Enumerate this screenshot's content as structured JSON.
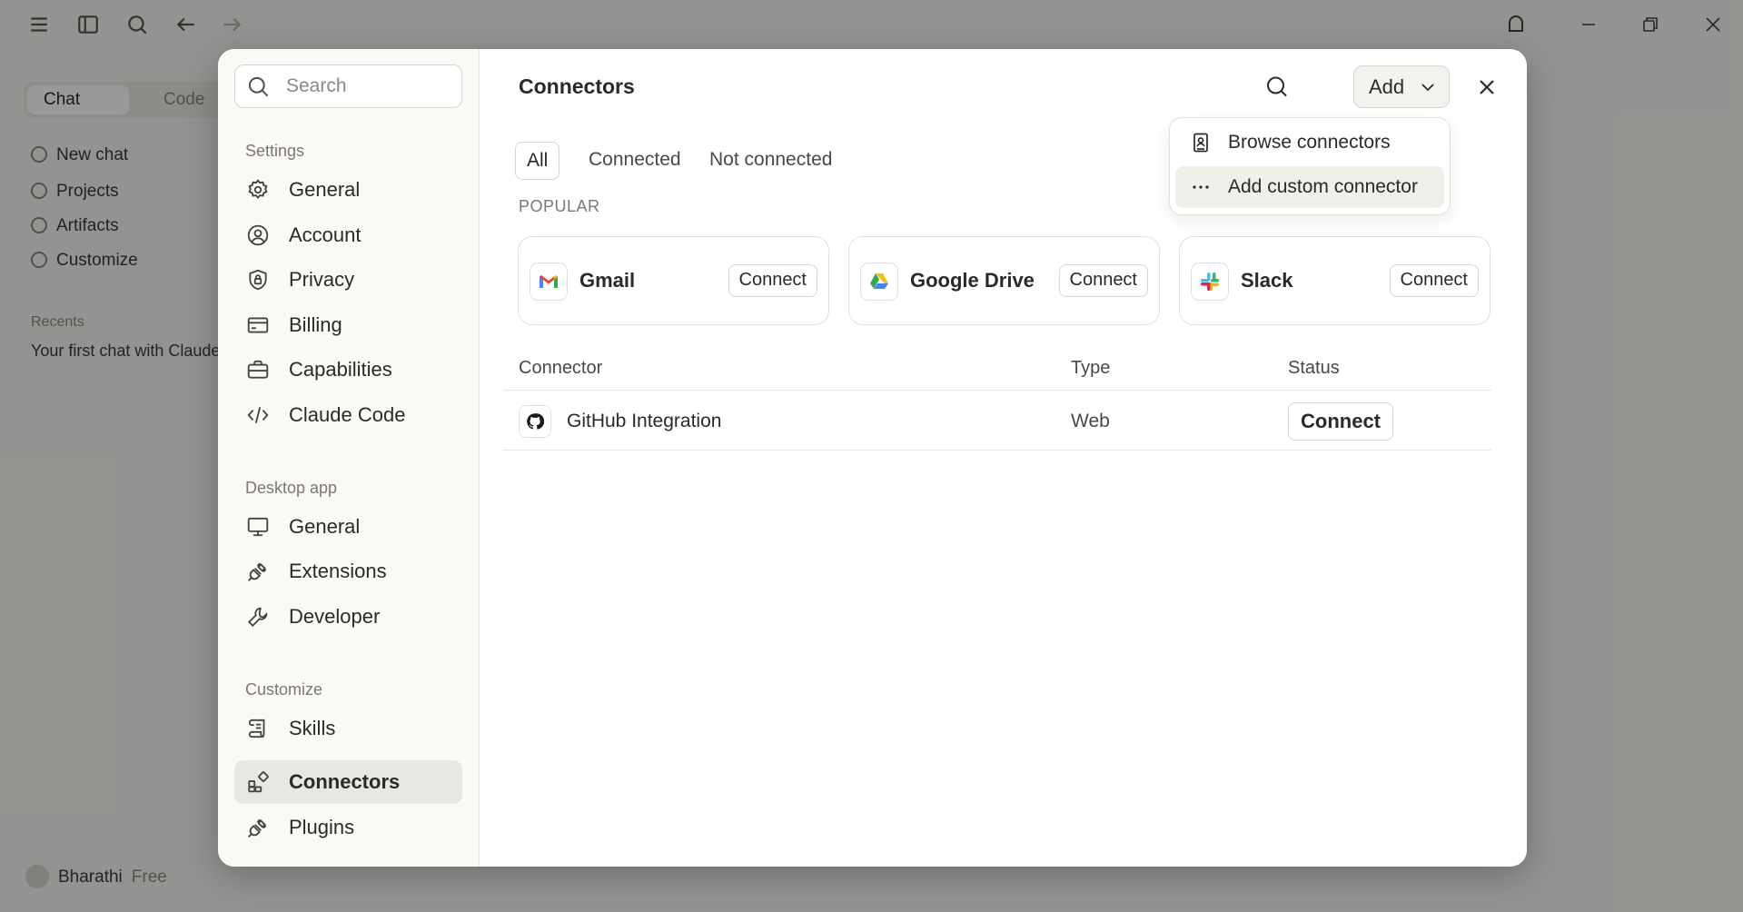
{
  "background": {
    "sidebar_tabs": [
      "Chat",
      "Code"
    ],
    "nav_items": [
      "New chat",
      "Projects",
      "Artifacts",
      "Customize"
    ],
    "recents_label": "Recents",
    "recent_item": "Your first chat with Claude",
    "user_name": "Bharathi",
    "user_plan": "Free"
  },
  "modal": {
    "search_placeholder": "Search",
    "sections": [
      {
        "heading": "Settings",
        "items": [
          {
            "label": "General",
            "icon": "gear-icon"
          },
          {
            "label": "Account",
            "icon": "user-circle-icon"
          },
          {
            "label": "Privacy",
            "icon": "shield-lock-icon"
          },
          {
            "label": "Billing",
            "icon": "credit-card-icon"
          },
          {
            "label": "Capabilities",
            "icon": "briefcase-icon"
          },
          {
            "label": "Claude Code",
            "icon": "code-icon"
          }
        ]
      },
      {
        "heading": "Desktop app",
        "items": [
          {
            "label": "General",
            "icon": "monitor-icon"
          },
          {
            "label": "Extensions",
            "icon": "plug-icon"
          },
          {
            "label": "Developer",
            "icon": "wrench-icon"
          }
        ]
      },
      {
        "heading": "Customize",
        "items": [
          {
            "label": "Skills",
            "icon": "scroll-icon"
          },
          {
            "label": "Connectors",
            "icon": "connectors-icon",
            "selected": true
          },
          {
            "label": "Plugins",
            "icon": "plug-icon"
          }
        ]
      }
    ],
    "title": "Connectors",
    "add_label": "Add",
    "tabs": [
      "All",
      "Connected",
      "Not connected"
    ],
    "active_tab": "All",
    "popular_label": "POPULAR",
    "popular": [
      {
        "name": "Gmail",
        "button": "Connect"
      },
      {
        "name": "Google Drive",
        "button": "Connect"
      },
      {
        "name": "Slack",
        "button": "Connect"
      }
    ],
    "table": {
      "headers": [
        "Connector",
        "Type",
        "Status"
      ],
      "rows": [
        {
          "name": "GitHub Integration",
          "type": "Web",
          "status_button": "Connect"
        }
      ]
    },
    "dropdown": [
      {
        "label": "Browse connectors",
        "icon": "book-user-icon"
      },
      {
        "label": "Add custom connector",
        "icon": "more-horizontal-icon"
      }
    ]
  }
}
